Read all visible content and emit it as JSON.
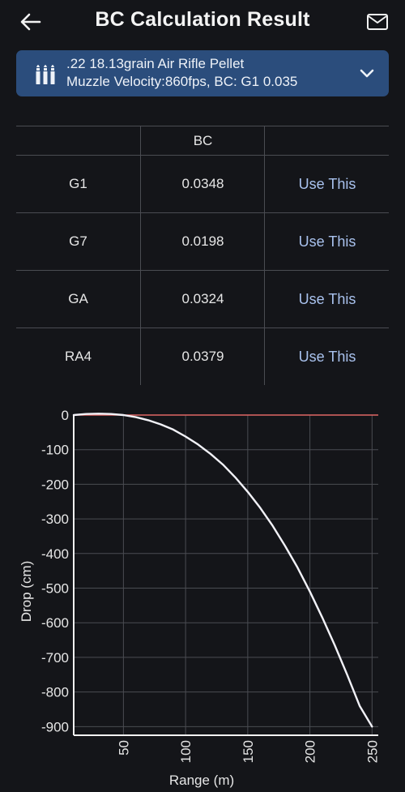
{
  "header": {
    "title": "BC Calculation Result"
  },
  "ammo": {
    "line1": ".22 18.13grain Air Rifle Pellet",
    "line2": "Muzzle Velocity:860fps, BC: G1 0.035"
  },
  "table": {
    "column_header": "BC",
    "rows": [
      {
        "model": "G1",
        "bc": "0.0348",
        "action": "Use This"
      },
      {
        "model": "G7",
        "bc": "0.0198",
        "action": "Use This"
      },
      {
        "model": "GA",
        "bc": "0.0324",
        "action": "Use This"
      },
      {
        "model": "RA4",
        "bc": "0.0379",
        "action": "Use This"
      }
    ]
  },
  "chart_data": {
    "type": "line",
    "xlabel": "Range (m)",
    "ylabel": "Drop (cm)",
    "xlim": [
      10,
      255
    ],
    "ylim": [
      -925,
      0
    ],
    "x_ticks": [
      50,
      100,
      150,
      200,
      250
    ],
    "y_ticks": [
      0,
      -100,
      -200,
      -300,
      -400,
      -500,
      -600,
      -700,
      -800,
      -900
    ],
    "grid": true,
    "reference_line": {
      "y": 0,
      "color": "#e06666"
    },
    "series": [
      {
        "color": "#f2f2f8",
        "x": [
          10,
          20,
          30,
          40,
          50,
          60,
          70,
          80,
          90,
          100,
          110,
          120,
          130,
          140,
          150,
          160,
          170,
          180,
          190,
          200,
          210,
          220,
          230,
          240,
          250
        ],
        "y": [
          0,
          3,
          4,
          3,
          0,
          -6,
          -15,
          -27,
          -42,
          -62,
          -85,
          -112,
          -143,
          -180,
          -222,
          -268,
          -320,
          -378,
          -440,
          -510,
          -585,
          -665,
          -750,
          -840,
          -900
        ]
      }
    ]
  },
  "colors": {
    "background": "#141519",
    "card": "#2b4d7c",
    "link": "#a9c2ee",
    "grid": "#4a4c52"
  }
}
